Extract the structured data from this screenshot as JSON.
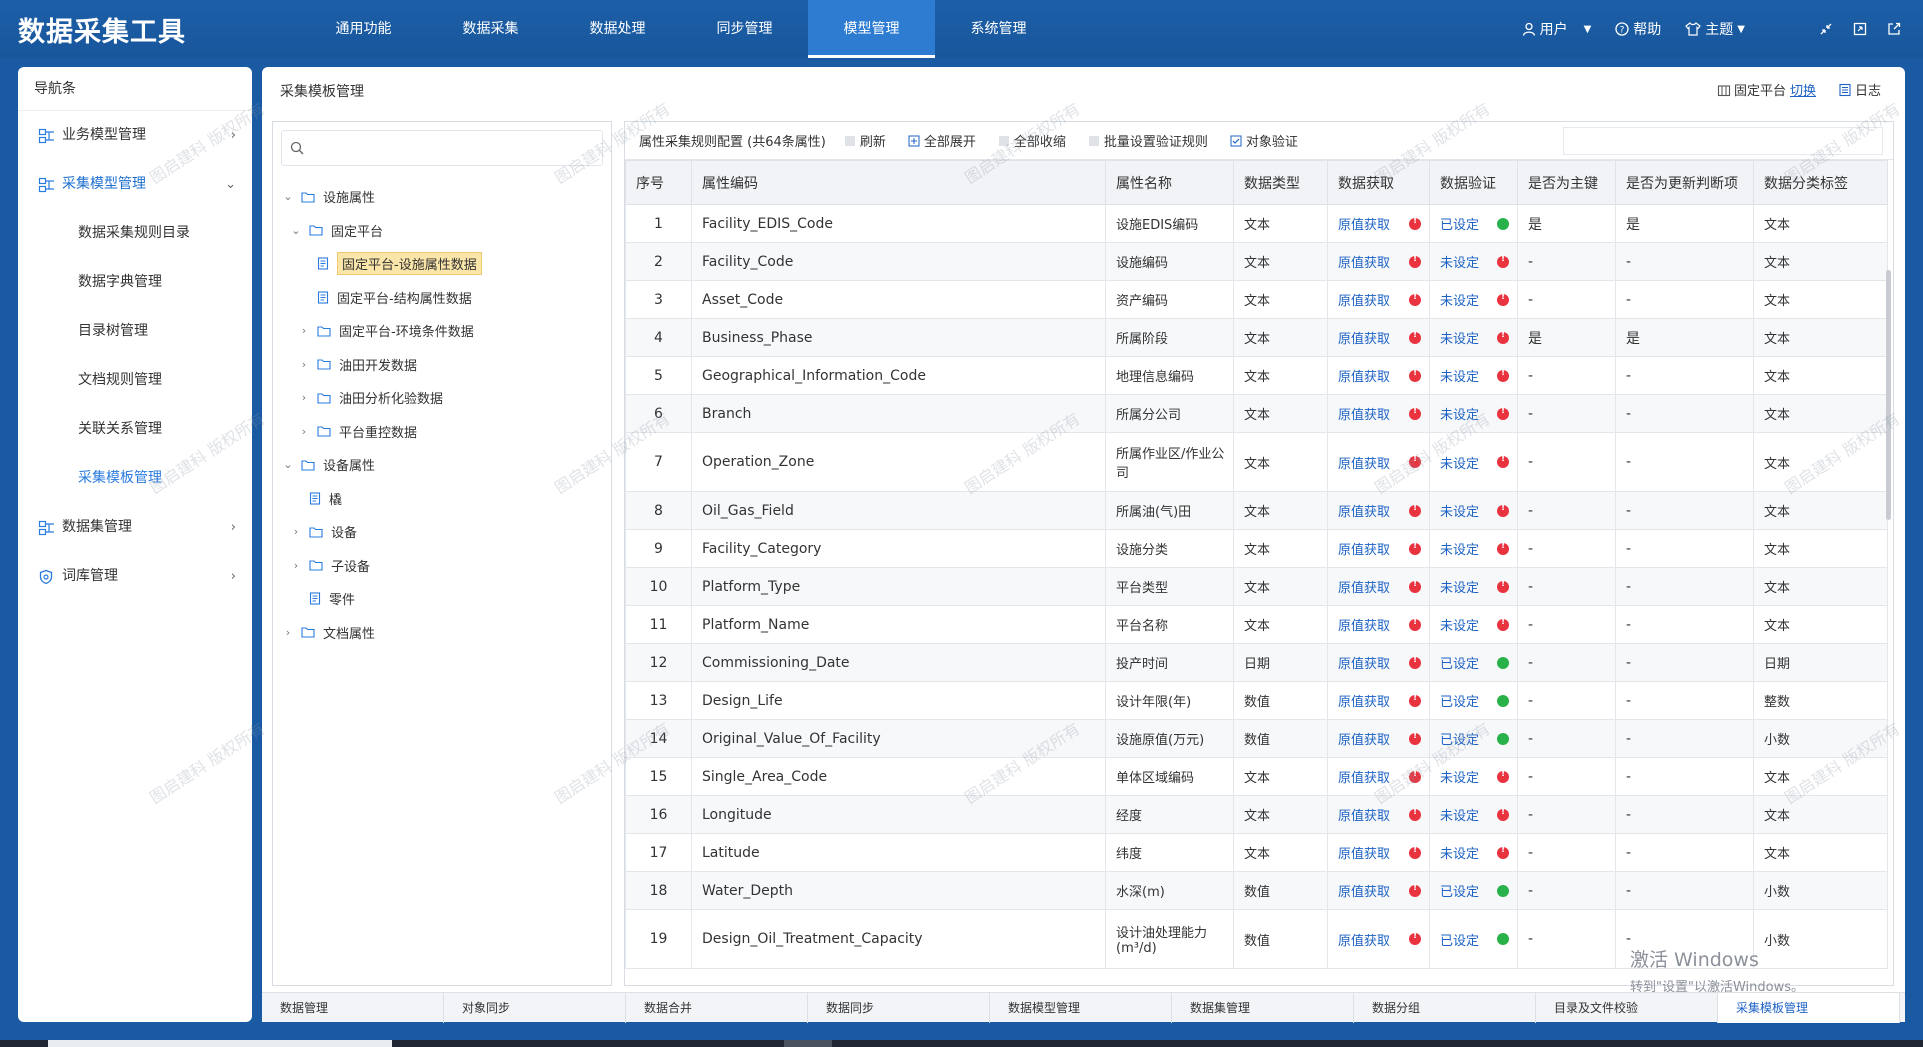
{
  "app_title": "数据采集工具",
  "top_nav": [
    "通用功能",
    "数据采集",
    "数据处理",
    "同步管理",
    "模型管理",
    "系统管理"
  ],
  "top_nav_active": 4,
  "top_right": {
    "user": "用户",
    "help": "帮助",
    "theme": "主题"
  },
  "left_panel": {
    "title": "导航条",
    "groups": [
      {
        "label": "业务模型管理",
        "icon": "model-icon",
        "chevron": "›"
      },
      {
        "label": "采集模型管理",
        "icon": "model-icon",
        "chevron": "⌄",
        "open": true,
        "children": [
          "数据采集规则目录",
          "数据字典管理",
          "目录树管理",
          "文档规则管理",
          "关联关系管理",
          "采集模板管理"
        ],
        "active_child": 5
      },
      {
        "label": "数据集管理",
        "icon": "dataset-icon",
        "chevron": "›"
      },
      {
        "label": "词库管理",
        "icon": "shield-icon",
        "chevron": "›"
      }
    ]
  },
  "main": {
    "title": "采集模板管理",
    "actions": {
      "platform_label": "固定平台",
      "switch_label": "切换",
      "log_label": "日志"
    }
  },
  "tree": {
    "search_placeholder": "",
    "nodes": [
      {
        "label": "设施属性",
        "level": 0,
        "arrow": "⌄"
      },
      {
        "label": "固定平台",
        "level": 1,
        "arrow": "⌄"
      },
      {
        "label": "固定平台-设施属性数据",
        "level": 2,
        "arrow": "",
        "selected": true,
        "leaf": true
      },
      {
        "label": "固定平台-结构属性数据",
        "level": 2,
        "arrow": "",
        "leaf": true
      },
      {
        "label": "固定平台-环境条件数据",
        "level": 2,
        "arrow": "›"
      },
      {
        "label": "油田开发数据",
        "level": 2,
        "arrow": "›"
      },
      {
        "label": "油田分析化验数据",
        "level": 2,
        "arrow": "›"
      },
      {
        "label": "平台重控数据",
        "level": 2,
        "arrow": "›"
      },
      {
        "label": "设备属性",
        "level": 0,
        "arrow": "⌄"
      },
      {
        "label": "橇",
        "level": 1,
        "arrow": "",
        "leaf": true
      },
      {
        "label": "设备",
        "level": 1,
        "arrow": "›"
      },
      {
        "label": "子设备",
        "level": 1,
        "arrow": "›"
      },
      {
        "label": "零件",
        "level": 1,
        "arrow": "",
        "leaf": true
      },
      {
        "label": "文档属性",
        "level": 0,
        "arrow": "›"
      }
    ]
  },
  "toolbar": {
    "title": "属性采集规则配置 (共64条属性)",
    "refresh": "刷新",
    "expand_all": "全部展开",
    "collapse_all": "全部收缩",
    "batch_verify": "批量设置验证规则",
    "object_verify": "对象验证"
  },
  "table": {
    "headers": [
      "序号",
      "属性编码",
      "属性名称",
      "数据类型",
      "数据获取",
      "数据验证",
      "是否为主键",
      "是否为更新判断项",
      "数据分类标签"
    ],
    "rows": [
      {
        "idx": "1",
        "code": "Facility_EDIS_Code",
        "name": "设施EDIS编码",
        "type": "文本",
        "get": "原值获取",
        "get_status": "red",
        "verify": "已设定",
        "verify_status": "green",
        "pk": "是",
        "upd": "是",
        "cat": "文本"
      },
      {
        "idx": "2",
        "code": "Facility_Code",
        "name": "设施编码",
        "type": "文本",
        "get": "原值获取",
        "get_status": "red",
        "verify": "未设定",
        "verify_status": "red",
        "pk": "-",
        "upd": "-",
        "cat": "文本"
      },
      {
        "idx": "3",
        "code": "Asset_Code",
        "name": "资产编码",
        "type": "文本",
        "get": "原值获取",
        "get_status": "red",
        "verify": "未设定",
        "verify_status": "red",
        "pk": "-",
        "upd": "-",
        "cat": "文本"
      },
      {
        "idx": "4",
        "code": "Business_Phase",
        "name": "所属阶段",
        "type": "文本",
        "get": "原值获取",
        "get_status": "red",
        "verify": "未设定",
        "verify_status": "red",
        "pk": "是",
        "upd": "是",
        "cat": "文本"
      },
      {
        "idx": "5",
        "code": "Geographical_Information_Code",
        "name": "地理信息编码",
        "type": "文本",
        "get": "原值获取",
        "get_status": "red",
        "verify": "未设定",
        "verify_status": "red",
        "pk": "-",
        "upd": "-",
        "cat": "文本"
      },
      {
        "idx": "6",
        "code": "Branch",
        "name": "所属分公司",
        "type": "文本",
        "get": "原值获取",
        "get_status": "red",
        "verify": "未设定",
        "verify_status": "red",
        "pk": "-",
        "upd": "-",
        "cat": "文本"
      },
      {
        "idx": "7",
        "code": "Operation_Zone",
        "name": "所属作业区/作业公司",
        "type": "文本",
        "get": "原值获取",
        "get_status": "red",
        "verify": "未设定",
        "verify_status": "red",
        "pk": "-",
        "upd": "-",
        "cat": "文本",
        "tall": true
      },
      {
        "idx": "8",
        "code": "Oil_Gas_Field",
        "name": "所属油(气)田",
        "type": "文本",
        "get": "原值获取",
        "get_status": "red",
        "verify": "未设定",
        "verify_status": "red",
        "pk": "-",
        "upd": "-",
        "cat": "文本"
      },
      {
        "idx": "9",
        "code": "Facility_Category",
        "name": "设施分类",
        "type": "文本",
        "get": "原值获取",
        "get_status": "red",
        "verify": "未设定",
        "verify_status": "red",
        "pk": "-",
        "upd": "-",
        "cat": "文本"
      },
      {
        "idx": "10",
        "code": "Platform_Type",
        "name": "平台类型",
        "type": "文本",
        "get": "原值获取",
        "get_status": "red",
        "verify": "未设定",
        "verify_status": "red",
        "pk": "-",
        "upd": "-",
        "cat": "文本"
      },
      {
        "idx": "11",
        "code": "Platform_Name",
        "name": "平台名称",
        "type": "文本",
        "get": "原值获取",
        "get_status": "red",
        "verify": "未设定",
        "verify_status": "red",
        "pk": "-",
        "upd": "-",
        "cat": "文本"
      },
      {
        "idx": "12",
        "code": "Commissioning_Date",
        "name": "投产时间",
        "type": "日期",
        "get": "原值获取",
        "get_status": "red",
        "verify": "已设定",
        "verify_status": "green",
        "pk": "-",
        "upd": "-",
        "cat": "日期"
      },
      {
        "idx": "13",
        "code": "Design_Life",
        "name": "设计年限(年)",
        "type": "数值",
        "get": "原值获取",
        "get_status": "red",
        "verify": "已设定",
        "verify_status": "green",
        "pk": "-",
        "upd": "-",
        "cat": "整数"
      },
      {
        "idx": "14",
        "code": "Original_Value_Of_Facility",
        "name": "设施原值(万元)",
        "type": "数值",
        "get": "原值获取",
        "get_status": "red",
        "verify": "已设定",
        "verify_status": "green",
        "pk": "-",
        "upd": "-",
        "cat": "小数"
      },
      {
        "idx": "15",
        "code": "Single_Area_Code",
        "name": "单体区域编码",
        "type": "文本",
        "get": "原值获取",
        "get_status": "red",
        "verify": "未设定",
        "verify_status": "red",
        "pk": "-",
        "upd": "-",
        "cat": "文本"
      },
      {
        "idx": "16",
        "code": "Longitude",
        "name": "经度",
        "type": "文本",
        "get": "原值获取",
        "get_status": "red",
        "verify": "未设定",
        "verify_status": "red",
        "pk": "-",
        "upd": "-",
        "cat": "文本"
      },
      {
        "idx": "17",
        "code": "Latitude",
        "name": "纬度",
        "type": "文本",
        "get": "原值获取",
        "get_status": "red",
        "verify": "未设定",
        "verify_status": "red",
        "pk": "-",
        "upd": "-",
        "cat": "文本"
      },
      {
        "idx": "18",
        "code": "Water_Depth",
        "name": "水深(m)",
        "type": "数值",
        "get": "原值获取",
        "get_status": "red",
        "verify": "已设定",
        "verify_status": "green",
        "pk": "-",
        "upd": "-",
        "cat": "小数"
      },
      {
        "idx": "19",
        "code": "Design_Oil_Treatment_Capacity",
        "name": "设计油处理能力(m³/d)",
        "type": "数值",
        "get": "原值获取",
        "get_status": "red",
        "verify": "已设定",
        "verify_status": "green",
        "pk": "-",
        "upd": "-",
        "cat": "小数",
        "tall": true
      }
    ]
  },
  "bottom_tabs": [
    "数据管理",
    "对象同步",
    "数据合并",
    "数据同步",
    "数据模型管理",
    "数据集管理",
    "数据分组",
    "目录及文件校验",
    "采集模板管理"
  ],
  "bottom_tab_active": 8,
  "activate_windows": {
    "title": "激活 Windows",
    "sub": "转到\"设置\"以激活Windows。"
  },
  "watermark": "图启建科 版权所有",
  "colors": {
    "topbar": "#1a5aa3",
    "link": "#1e63c4",
    "status_red": "#e9333f",
    "status_green": "#2ab24a",
    "selected_tree": "#fbe6a9"
  }
}
